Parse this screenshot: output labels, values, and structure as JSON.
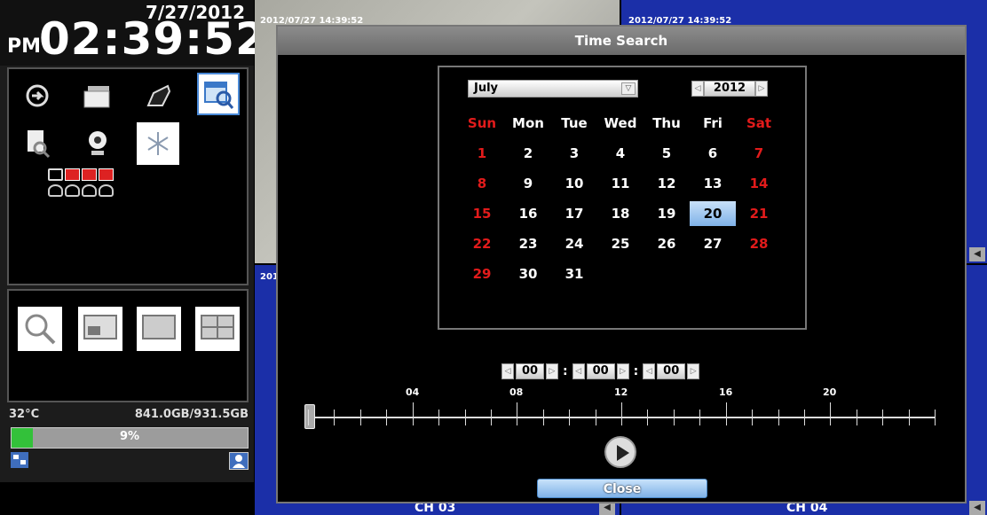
{
  "clock": {
    "date": "7/27/2012",
    "ampm": "PM",
    "time": "02:39:52"
  },
  "status": {
    "temperature": "32°C",
    "disk": "841.0GB/931.5GB",
    "usage_label": "9%",
    "usage_fraction": 0.09
  },
  "channels": {
    "ch1": {
      "timestamp": "2012/07/27 14:39:52"
    },
    "ch2": {
      "timestamp": "2012/07/27 14:39:52"
    },
    "ch3": {
      "timestamp": "201",
      "label": "CH 03"
    },
    "ch4": {
      "label": "CH 04"
    }
  },
  "dialog": {
    "title": "Time Search",
    "month": "July",
    "year": "2012",
    "weekdays": [
      "Sun",
      "Mon",
      "Tue",
      "Wed",
      "Thu",
      "Fri",
      "Sat"
    ],
    "weeks": [
      [
        "1",
        "2",
        "3",
        "4",
        "5",
        "6",
        "7"
      ],
      [
        "8",
        "9",
        "10",
        "11",
        "12",
        "13",
        "14"
      ],
      [
        "15",
        "16",
        "17",
        "18",
        "19",
        "20",
        "21"
      ],
      [
        "22",
        "23",
        "24",
        "25",
        "26",
        "27",
        "28"
      ],
      [
        "29",
        "30",
        "31",
        "",
        "",
        "",
        ""
      ]
    ],
    "selected_day": "20",
    "time": {
      "hour": "00",
      "minute": "00",
      "second": "00"
    },
    "timeline_labels": [
      "04",
      "08",
      "12",
      "16",
      "20"
    ],
    "close_label": "Close"
  },
  "colors": {
    "weekend": "#e21b1b",
    "video_blue": "#1b2fa8",
    "usage_green": "#33c13a"
  }
}
